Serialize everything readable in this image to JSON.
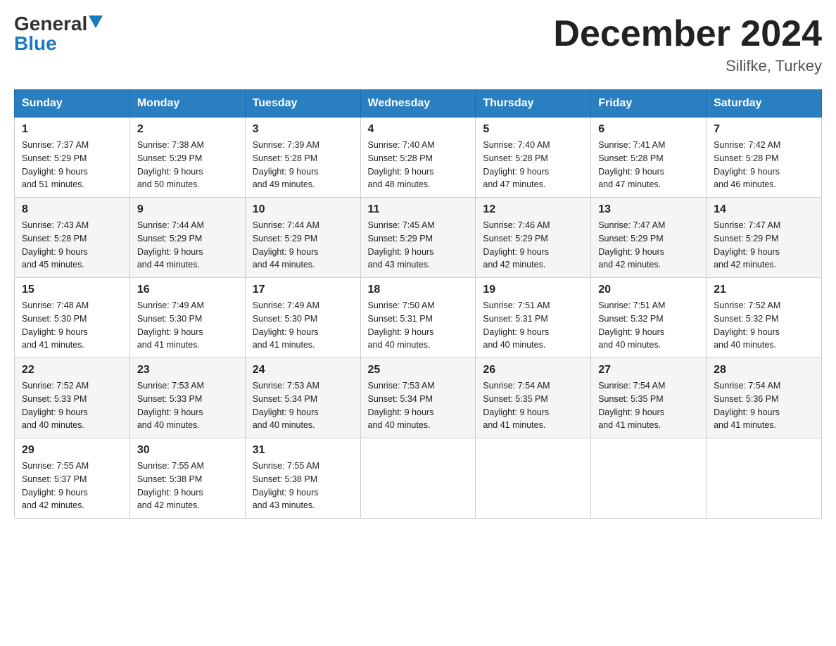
{
  "header": {
    "logo_general": "General",
    "logo_blue": "Blue",
    "month_title": "December 2024",
    "location": "Silifke, Turkey"
  },
  "days_of_week": [
    "Sunday",
    "Monday",
    "Tuesday",
    "Wednesday",
    "Thursday",
    "Friday",
    "Saturday"
  ],
  "weeks": [
    [
      {
        "day": "1",
        "sunrise": "7:37 AM",
        "sunset": "5:29 PM",
        "daylight": "9 hours and 51 minutes."
      },
      {
        "day": "2",
        "sunrise": "7:38 AM",
        "sunset": "5:29 PM",
        "daylight": "9 hours and 50 minutes."
      },
      {
        "day": "3",
        "sunrise": "7:39 AM",
        "sunset": "5:28 PM",
        "daylight": "9 hours and 49 minutes."
      },
      {
        "day": "4",
        "sunrise": "7:40 AM",
        "sunset": "5:28 PM",
        "daylight": "9 hours and 48 minutes."
      },
      {
        "day": "5",
        "sunrise": "7:40 AM",
        "sunset": "5:28 PM",
        "daylight": "9 hours and 47 minutes."
      },
      {
        "day": "6",
        "sunrise": "7:41 AM",
        "sunset": "5:28 PM",
        "daylight": "9 hours and 47 minutes."
      },
      {
        "day": "7",
        "sunrise": "7:42 AM",
        "sunset": "5:28 PM",
        "daylight": "9 hours and 46 minutes."
      }
    ],
    [
      {
        "day": "8",
        "sunrise": "7:43 AM",
        "sunset": "5:28 PM",
        "daylight": "9 hours and 45 minutes."
      },
      {
        "day": "9",
        "sunrise": "7:44 AM",
        "sunset": "5:29 PM",
        "daylight": "9 hours and 44 minutes."
      },
      {
        "day": "10",
        "sunrise": "7:44 AM",
        "sunset": "5:29 PM",
        "daylight": "9 hours and 44 minutes."
      },
      {
        "day": "11",
        "sunrise": "7:45 AM",
        "sunset": "5:29 PM",
        "daylight": "9 hours and 43 minutes."
      },
      {
        "day": "12",
        "sunrise": "7:46 AM",
        "sunset": "5:29 PM",
        "daylight": "9 hours and 42 minutes."
      },
      {
        "day": "13",
        "sunrise": "7:47 AM",
        "sunset": "5:29 PM",
        "daylight": "9 hours and 42 minutes."
      },
      {
        "day": "14",
        "sunrise": "7:47 AM",
        "sunset": "5:29 PM",
        "daylight": "9 hours and 42 minutes."
      }
    ],
    [
      {
        "day": "15",
        "sunrise": "7:48 AM",
        "sunset": "5:30 PM",
        "daylight": "9 hours and 41 minutes."
      },
      {
        "day": "16",
        "sunrise": "7:49 AM",
        "sunset": "5:30 PM",
        "daylight": "9 hours and 41 minutes."
      },
      {
        "day": "17",
        "sunrise": "7:49 AM",
        "sunset": "5:30 PM",
        "daylight": "9 hours and 41 minutes."
      },
      {
        "day": "18",
        "sunrise": "7:50 AM",
        "sunset": "5:31 PM",
        "daylight": "9 hours and 40 minutes."
      },
      {
        "day": "19",
        "sunrise": "7:51 AM",
        "sunset": "5:31 PM",
        "daylight": "9 hours and 40 minutes."
      },
      {
        "day": "20",
        "sunrise": "7:51 AM",
        "sunset": "5:32 PM",
        "daylight": "9 hours and 40 minutes."
      },
      {
        "day": "21",
        "sunrise": "7:52 AM",
        "sunset": "5:32 PM",
        "daylight": "9 hours and 40 minutes."
      }
    ],
    [
      {
        "day": "22",
        "sunrise": "7:52 AM",
        "sunset": "5:33 PM",
        "daylight": "9 hours and 40 minutes."
      },
      {
        "day": "23",
        "sunrise": "7:53 AM",
        "sunset": "5:33 PM",
        "daylight": "9 hours and 40 minutes."
      },
      {
        "day": "24",
        "sunrise": "7:53 AM",
        "sunset": "5:34 PM",
        "daylight": "9 hours and 40 minutes."
      },
      {
        "day": "25",
        "sunrise": "7:53 AM",
        "sunset": "5:34 PM",
        "daylight": "9 hours and 40 minutes."
      },
      {
        "day": "26",
        "sunrise": "7:54 AM",
        "sunset": "5:35 PM",
        "daylight": "9 hours and 41 minutes."
      },
      {
        "day": "27",
        "sunrise": "7:54 AM",
        "sunset": "5:35 PM",
        "daylight": "9 hours and 41 minutes."
      },
      {
        "day": "28",
        "sunrise": "7:54 AM",
        "sunset": "5:36 PM",
        "daylight": "9 hours and 41 minutes."
      }
    ],
    [
      {
        "day": "29",
        "sunrise": "7:55 AM",
        "sunset": "5:37 PM",
        "daylight": "9 hours and 42 minutes."
      },
      {
        "day": "30",
        "sunrise": "7:55 AM",
        "sunset": "5:38 PM",
        "daylight": "9 hours and 42 minutes."
      },
      {
        "day": "31",
        "sunrise": "7:55 AM",
        "sunset": "5:38 PM",
        "daylight": "9 hours and 43 minutes."
      },
      null,
      null,
      null,
      null
    ]
  ],
  "labels": {
    "sunrise": "Sunrise:",
    "sunset": "Sunset:",
    "daylight": "Daylight:"
  }
}
